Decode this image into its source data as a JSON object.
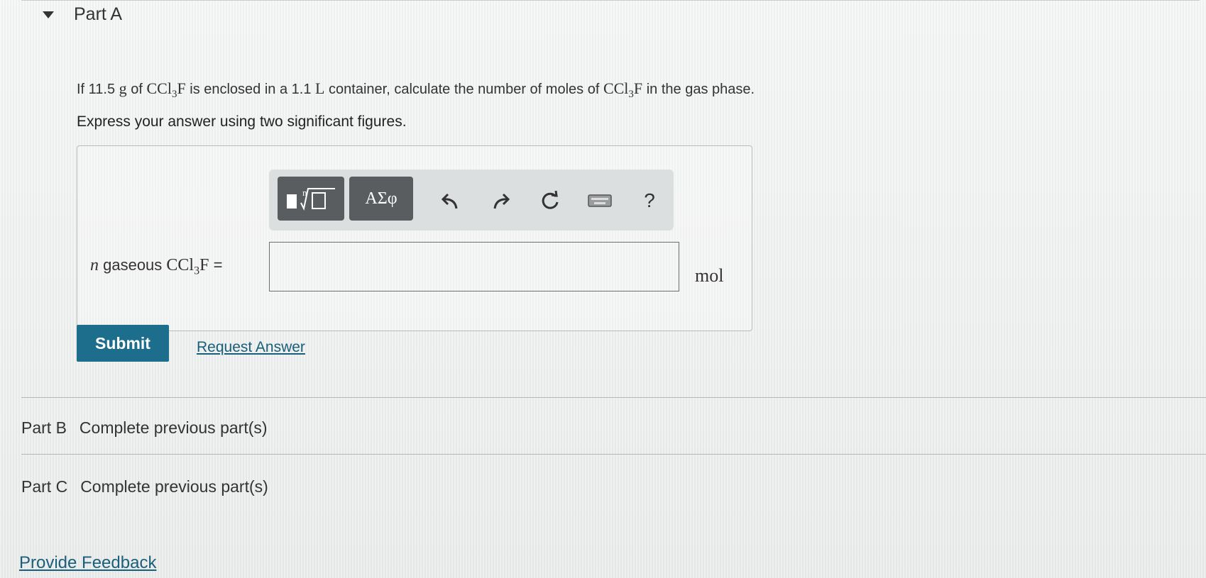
{
  "part_a": {
    "title": "Part A",
    "question_prefix": "If 11.5 ",
    "q_mass_unit": "g",
    "q_of": " of ",
    "q_formula1": "CCl",
    "q_sub1": "3",
    "q_formula1_end": "F",
    "q_mid1": " is enclosed in a 1.1 ",
    "q_volume_unit": "L",
    "q_mid2": " container, calculate the number of moles of ",
    "q_formula2": "CCl",
    "q_sub2": "3",
    "q_formula2_end": "F",
    "q_suffix": " in the gas phase.",
    "instruction": "Express your answer using two significant figures."
  },
  "toolbar": {
    "symbols_label": "ΑΣφ",
    "help_label": "?"
  },
  "answer": {
    "var_n": "n",
    "var_text": " gaseous ",
    "var_formula": "CCl",
    "var_sub": "3",
    "var_formula_end": "F",
    "var_equals": " =",
    "input_value": "",
    "unit": "mol"
  },
  "actions": {
    "submit_label": "Submit",
    "request_answer_label": "Request Answer"
  },
  "parts": [
    {
      "label": "Part B",
      "status": "Complete previous part(s)"
    },
    {
      "label": "Part C",
      "status": "Complete previous part(s)"
    }
  ],
  "footer": {
    "feedback_label": "Provide Feedback"
  }
}
